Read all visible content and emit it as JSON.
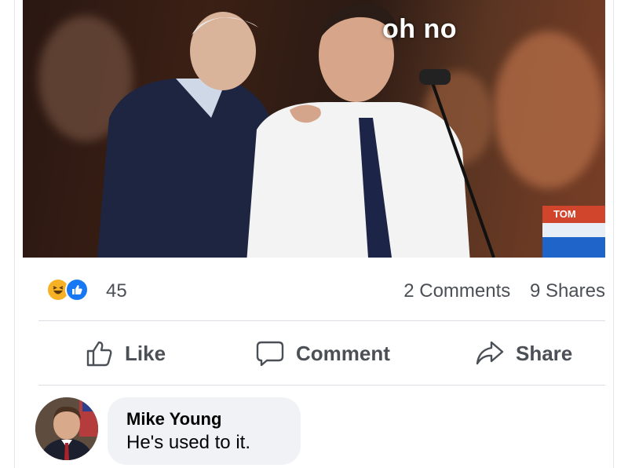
{
  "post": {
    "media": {
      "caption": "oh no",
      "tv_badge": "TOM"
    },
    "stats": {
      "reaction_icons": [
        "haha-icon",
        "like-icon"
      ],
      "reaction_count": "45",
      "comments": "2 Comments",
      "shares": "9 Shares"
    },
    "actions": {
      "like": "Like",
      "comment": "Comment",
      "share": "Share"
    },
    "comment": {
      "author": "Mike Young",
      "text": "He's used to it."
    }
  },
  "colors": {
    "like_blue": "#1877f2",
    "haha_yellow": "#f7b125",
    "muted_text": "#4b4f56",
    "bubble_bg": "#f0f2f5"
  }
}
